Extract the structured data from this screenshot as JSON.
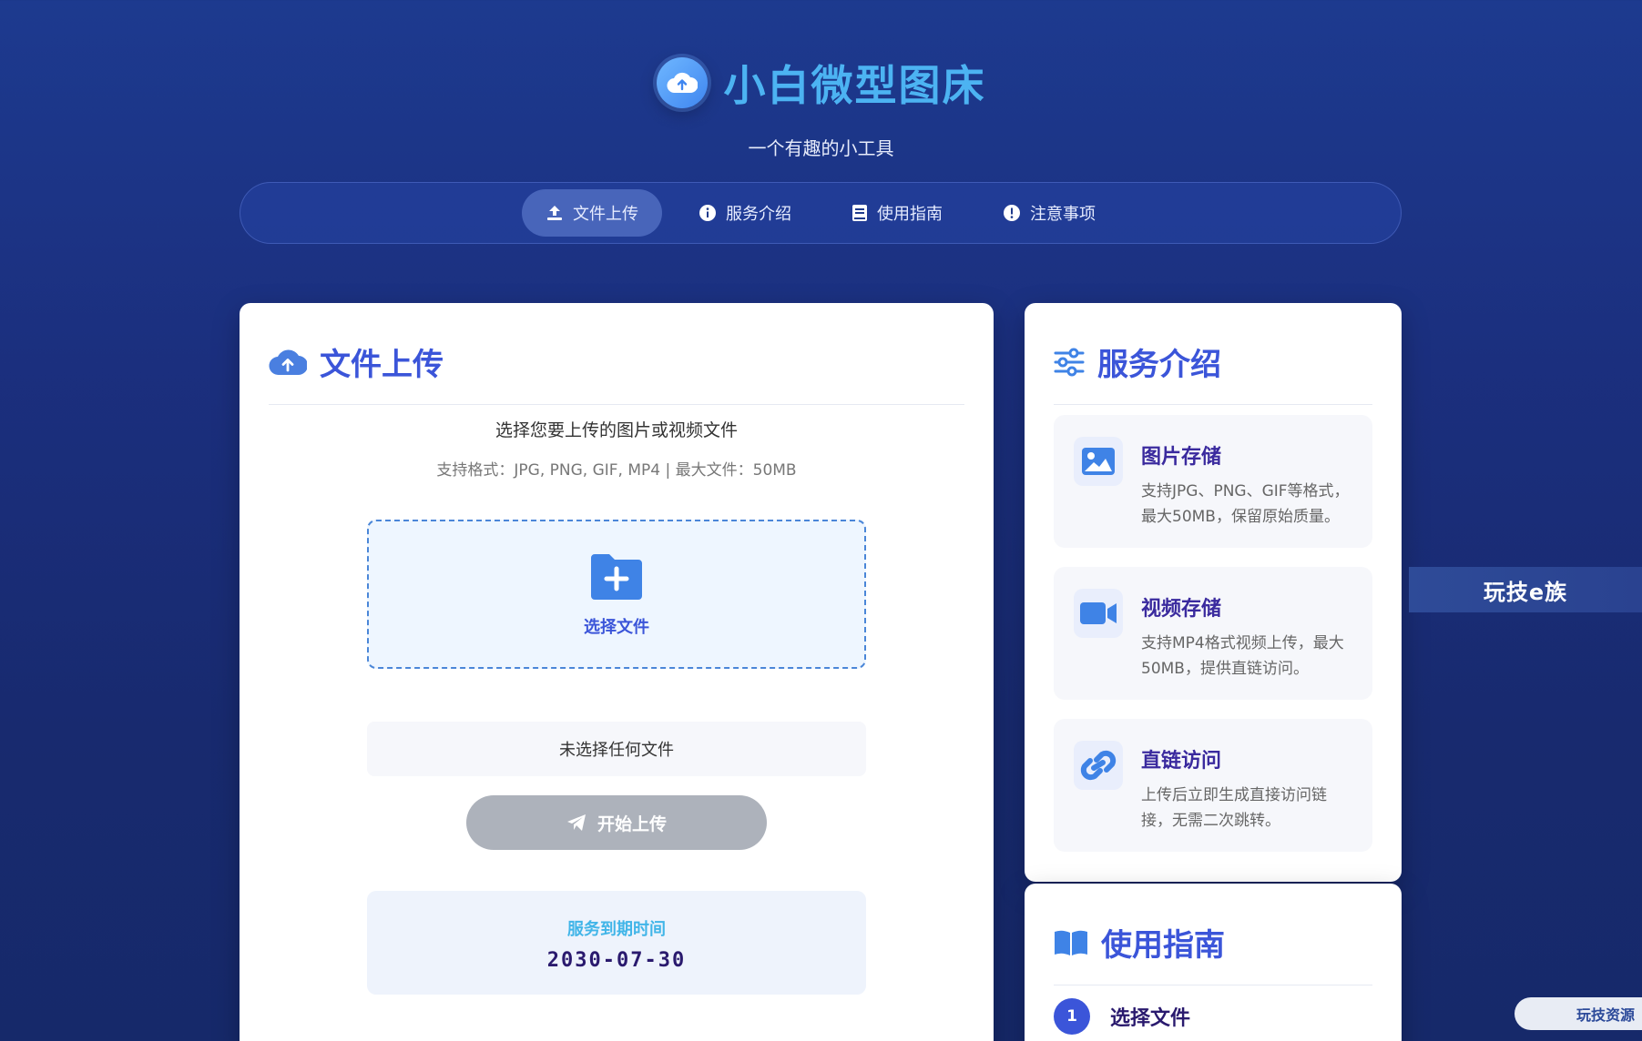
{
  "header": {
    "title": "小白微型图床",
    "subtitle": "一个有趣的小工具"
  },
  "nav": {
    "tabs": [
      {
        "label": "文件上传",
        "icon": "upload-icon",
        "active": true
      },
      {
        "label": "服务介绍",
        "icon": "info-icon",
        "active": false
      },
      {
        "label": "使用指南",
        "icon": "book-icon",
        "active": false
      },
      {
        "label": "注意事项",
        "icon": "alert-icon",
        "active": false
      }
    ]
  },
  "upload": {
    "title": "文件上传",
    "prompt": "选择您要上传的图片或视频文件",
    "formats": "支持格式：JPG, PNG, GIF, MP4 | 最大文件：50MB",
    "dropzone_label": "选择文件",
    "file_status": "未选择任何文件",
    "start_button": "开始上传",
    "expiry_label": "服务到期时间",
    "expiry_date": "2030-07-30"
  },
  "service": {
    "title": "服务介绍",
    "features": [
      {
        "title": "图片存储",
        "desc": "支持JPG、PNG、GIF等格式，最大50MB，保留原始质量。",
        "icon": "image-icon"
      },
      {
        "title": "视频存储",
        "desc": "支持MP4格式视频上传，最大50MB，提供直链访问。",
        "icon": "video-icon"
      },
      {
        "title": "直链访问",
        "desc": "上传后立即生成直接访问链接，无需二次跳转。",
        "icon": "link-icon"
      }
    ]
  },
  "guide": {
    "title": "使用指南",
    "steps": [
      {
        "number": "1",
        "label": "选择文件"
      }
    ]
  },
  "watermarks": {
    "side": "玩技e族",
    "corner": "玩技资源"
  },
  "colors": {
    "accent": "#3b55d9",
    "title_blue": "#4cb3f2",
    "background": "#1b2f7e",
    "disabled_button": "#adb2bb"
  }
}
